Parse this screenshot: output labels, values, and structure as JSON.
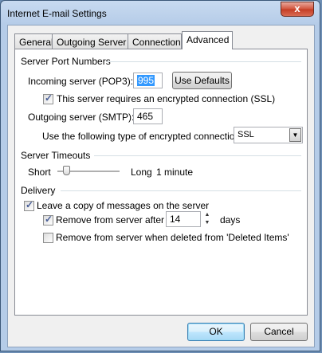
{
  "window": {
    "title": "Internet E-mail Settings",
    "close_glyph": "x"
  },
  "tabs": [
    "General",
    "Outgoing Server",
    "Connection",
    "Advanced"
  ],
  "server_ports": {
    "heading": "Server Port Numbers",
    "incoming_label": "Incoming server (POP3):",
    "incoming_value": "995",
    "use_defaults_label": "Use Defaults",
    "ssl_checkbox_label": "This server requires an encrypted connection (SSL)",
    "ssl_checked": true,
    "outgoing_label": "Outgoing server (SMTP):",
    "outgoing_value": "465",
    "encryption_label": "Use the following type of encrypted connection:",
    "encryption_value": "SSL"
  },
  "timeouts": {
    "heading": "Server Timeouts",
    "short_label": "Short",
    "long_label": "Long",
    "value_text": "1 minute",
    "slider_level": 0.1
  },
  "delivery": {
    "heading": "Delivery",
    "leave_copy_label": "Leave a copy of messages on the server",
    "leave_copy_checked": true,
    "remove_after_label": "Remove from server after",
    "remove_after_checked": true,
    "days_value": "14",
    "days_label": "days",
    "remove_deleted_label": "Remove from server when deleted from 'Deleted Items'",
    "remove_deleted_checked": false
  },
  "buttons": {
    "ok": "OK",
    "cancel": "Cancel"
  },
  "colors": {
    "selection": "#3399ff",
    "checkmark": "#4a5f97",
    "titlebar": "#b5cce8"
  }
}
